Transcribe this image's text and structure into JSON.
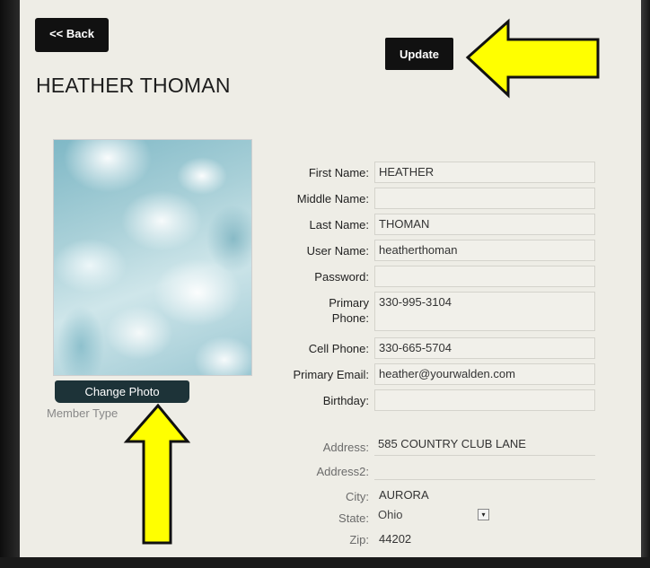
{
  "header": {
    "back_label": "<< Back",
    "update_label": "Update",
    "title": "HEATHER THOMAN"
  },
  "profile": {
    "change_photo_label": "Change Photo",
    "member_type_label": "Member Type"
  },
  "form": {
    "first_name": {
      "label": "First Name:",
      "value": "HEATHER"
    },
    "middle_name": {
      "label": "Middle Name:",
      "value": ""
    },
    "last_name": {
      "label": "Last Name:",
      "value": "THOMAN"
    },
    "user_name": {
      "label": "User Name:",
      "value": "heatherthoman"
    },
    "password": {
      "label": "Password:",
      "value": ""
    },
    "primary_phone": {
      "label_line1": "Primary",
      "label_line2": "Phone:",
      "value": "330-995-3104"
    },
    "cell_phone": {
      "label": "Cell Phone:",
      "value": "330-665-5704"
    },
    "primary_email": {
      "label": "Primary Email:",
      "value": "heather@yourwalden.com"
    },
    "birthday": {
      "label": "Birthday:",
      "value": ""
    },
    "address": {
      "label": "Address:",
      "value": "585 COUNTRY CLUB LANE"
    },
    "address2": {
      "label": "Address2:",
      "value": ""
    },
    "city": {
      "label": "City:",
      "value": "AURORA"
    },
    "state": {
      "label": "State:",
      "value": "Ohio"
    },
    "zip": {
      "label": "Zip:",
      "value": "44202"
    }
  },
  "icons": {
    "state_caret": "▾",
    "annotation_arrows": [
      "arrow-left-icon",
      "arrow-up-icon"
    ]
  },
  "colors": {
    "button_bg": "#111111",
    "change_photo_bg": "#1d3338",
    "arrow_fill": "#ffff00",
    "page_bg": "#eeede6"
  }
}
